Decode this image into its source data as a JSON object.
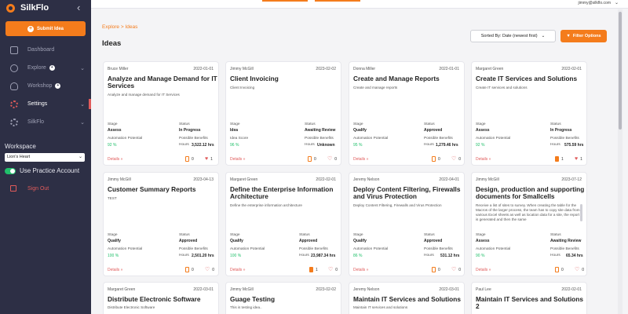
{
  "app": {
    "name": "SilkFlo",
    "collapse_icon": "chevron-left-icon",
    "submit_label": "Submit Idea"
  },
  "nav": [
    {
      "label": "Dashboard",
      "icon": "house-icon"
    },
    {
      "label": "Explore",
      "icon": "compass-icon",
      "badge": "+",
      "chevron": "⌄"
    },
    {
      "label": "Workshop",
      "icon": "bulb-icon",
      "badge": "+"
    },
    {
      "label": "Settings",
      "icon": "gear-icon",
      "chevron": "⌄",
      "active": true
    },
    {
      "label": "SilkFlo",
      "icon": "gear-icon",
      "chevron": "⌄"
    }
  ],
  "workspace": {
    "label": "Workspace",
    "selected": "Lion's Heart",
    "practice_label": "Use Practice Account",
    "practice_on": true
  },
  "signout_label": "Sign Out",
  "topbar": {
    "user_email": "jimmy@silkflo.com"
  },
  "breadcrumb": "Explore > Ideas",
  "page_title": "Ideas",
  "sort_label": "Sorted By: Date (newest first)",
  "filter_label": "Filter Options",
  "colors": {
    "accent": "#f47c1c",
    "sidebar": "#2d2f45",
    "danger": "#e05b5b",
    "success": "#21c06b"
  },
  "cards": [
    {
      "owner": "Bruce Miller",
      "date": "2022-01-01",
      "title": "Analyze and Manage Demand for IT Services",
      "desc": "Analyze and manage demand for IT Services",
      "stage_label": "Stage",
      "stage": "Assess",
      "status_label": "Status",
      "status": "In Progress",
      "metric_label": "Automation Potential",
      "metric": "92 %",
      "benefit_label": "Possible Benefits",
      "hours_label": "Hours",
      "hours": "3,522.12 hrs",
      "details": "Details »",
      "docs": "0",
      "likes": "1",
      "liked": true
    },
    {
      "owner": "Jimmy McGill",
      "date": "2023-02-02",
      "title": "Client Invoicing",
      "desc": "Client Invoicing",
      "stage_label": "Stage",
      "stage": "Idea",
      "status_label": "Status",
      "status": "Awaiting Review",
      "metric_label": "Idea Score",
      "metric": "96 %",
      "benefit_label": "Possible Benefits",
      "hours_label": "Hours",
      "hours": "Unknown",
      "details": "Details »",
      "docs": "0",
      "likes": "0",
      "liked": false
    },
    {
      "owner": "Donna Miller",
      "date": "2022-01-01",
      "title": "Create and Manage Reports",
      "desc": "Create and manage reports",
      "stage_label": "Stage",
      "stage": "Qualify",
      "status_label": "Status",
      "status": "Approved",
      "metric_label": "Automation Potential",
      "metric": "95 %",
      "benefit_label": "Possible Benefits",
      "hours_label": "Hours",
      "hours": "1,279.46 hrs",
      "details": "Details »",
      "docs": "0",
      "likes": "0",
      "liked": false
    },
    {
      "owner": "Margaret Green",
      "date": "2022-02-01",
      "title": "Create IT Services and Solutions",
      "desc": "Create IT services and solutions",
      "stage_label": "Stage",
      "stage": "Assess",
      "status_label": "Status",
      "status": "In Progress",
      "metric_label": "Automation Potential",
      "metric": "92 %",
      "benefit_label": "Possible Benefits",
      "hours_label": "Hours",
      "hours": "575.59 hrs",
      "details": "Details »",
      "docs": "1",
      "likes": "1",
      "liked": true,
      "doc_filled": true
    },
    {
      "owner": "Jimmy McGill",
      "date": "2023-04-13",
      "title": "Customer Summary Reports",
      "desc": "TEST",
      "stage_label": "Stage",
      "stage": "Qualify",
      "status_label": "Status",
      "status": "Approved",
      "metric_label": "Automation Potential",
      "metric": "100 %",
      "benefit_label": "Possible Benefits",
      "hours_label": "Hours",
      "hours": "2,501.20 hrs",
      "details": "Details »",
      "docs": "0",
      "likes": "0",
      "liked": false
    },
    {
      "owner": "Margaret Green",
      "date": "2022-02-01",
      "title": "Define the Enterprise Information Architecture",
      "desc": "Define the enterprise information architecture",
      "stage_label": "Stage",
      "stage": "Qualify",
      "status_label": "Status",
      "status": "Approved",
      "metric_label": "Automation Potential",
      "metric": "100 %",
      "benefit_label": "Possible Benefits",
      "hours_label": "Hours",
      "hours": "23,987.34 hrs",
      "details": "Details »",
      "docs": "1",
      "likes": "0",
      "liked": false,
      "doc_filled": true
    },
    {
      "owner": "Jeremy Nelson",
      "date": "2022-04-01",
      "title": "Deploy Content Filtering, Firewalls and Virus Protection",
      "desc": "Deploy Content Filtering, Firewalls and Virus Protection",
      "stage_label": "Stage",
      "stage": "Qualify",
      "status_label": "Status",
      "status": "Approved",
      "metric_label": "Automation Potential",
      "metric": "86 %",
      "benefit_label": "Possible Benefits",
      "hours_label": "Hours",
      "hours": "531.12 hrs",
      "details": "Details »",
      "docs": "0",
      "likes": "0",
      "liked": false
    },
    {
      "owner": "Jimmy McGill",
      "date": "2023-07-12",
      "title": "Design, production and supporting documents for Smallcells",
      "desc": "Receive a list of sites to survey. When creating the table for the Macros of the larger process, the team has to copy site data from various Excel sheets as well as location data for a site, the report is generated and then the same",
      "stage_label": "Stage",
      "stage": "Assess",
      "status_label": "Status",
      "status": "Awaiting Review",
      "metric_label": "Automation Potential",
      "metric": "90 %",
      "benefit_label": "Possible Benefits",
      "hours_label": "Hours",
      "hours": "65.34 hrs",
      "details": "Details »",
      "docs": "0",
      "likes": "0",
      "liked": false
    },
    {
      "owner": "Margaret Green",
      "date": "2022-03-01",
      "title": "Distribute Electronic Software",
      "desc": "Distribute Electronic Software"
    },
    {
      "owner": "Jimmy McGill",
      "date": "2023-02-02",
      "title": "Guage Testing",
      "desc": "This is testing idea.."
    },
    {
      "owner": "Jeremy Nelson",
      "date": "2022-03-01",
      "title": "Maintain IT Services and Solutions",
      "desc": "Maintain IT services and solutions"
    },
    {
      "owner": "Paul Lee",
      "date": "2022-02-01",
      "title": "Maintain IT Services and Solutions 2",
      "desc": ""
    }
  ]
}
